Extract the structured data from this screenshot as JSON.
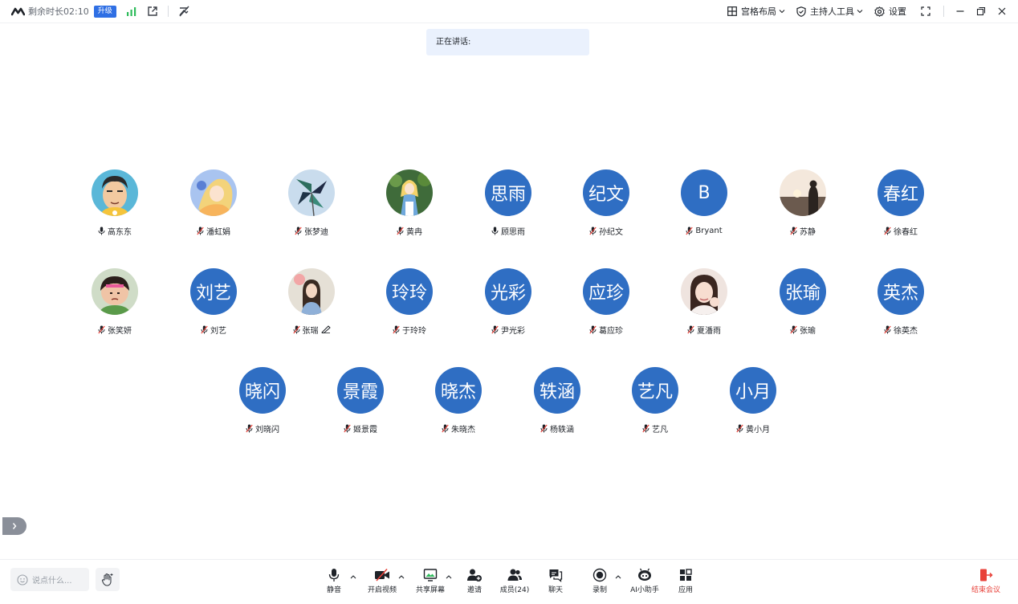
{
  "topbar": {
    "time_label": "剩余时长02:10",
    "upgrade": "升级",
    "layout_label": "宫格布局",
    "host_tools_label": "主持人工具",
    "settings_label": "设置"
  },
  "speaking_label": "正在讲话:",
  "participants": [
    {
      "name": "高东东",
      "avatar_text": "",
      "avatar_kind": "photo-man",
      "muted": false
    },
    {
      "name": "潘虹娟",
      "avatar_text": "",
      "avatar_kind": "photo-anime",
      "muted": true
    },
    {
      "name": "张梦迪",
      "avatar_text": "",
      "avatar_kind": "photo-pinwheel",
      "muted": true
    },
    {
      "name": "黄冉",
      "avatar_text": "",
      "avatar_kind": "photo-alice",
      "muted": true
    },
    {
      "name": "顾思雨",
      "avatar_text": "思雨",
      "avatar_kind": "text",
      "muted": false
    },
    {
      "name": "孙纪文",
      "avatar_text": "纪文",
      "avatar_kind": "text",
      "muted": true
    },
    {
      "name": "Bryant",
      "avatar_text": "B",
      "avatar_kind": "text",
      "muted": true
    },
    {
      "name": "苏静",
      "avatar_text": "",
      "avatar_kind": "photo-sunset",
      "muted": true
    },
    {
      "name": "徐春红",
      "avatar_text": "春红",
      "avatar_kind": "text",
      "muted": true
    },
    {
      "name": "张笑妍",
      "avatar_text": "",
      "avatar_kind": "photo-girl-cartoon",
      "muted": true
    },
    {
      "name": "刘艺",
      "avatar_text": "刘艺",
      "avatar_kind": "text",
      "muted": true
    },
    {
      "name": "张瑞",
      "avatar_text": "",
      "avatar_kind": "photo-woman",
      "muted": true,
      "annotating": true
    },
    {
      "name": "于玲玲",
      "avatar_text": "玲玲",
      "avatar_kind": "text",
      "muted": true
    },
    {
      "name": "尹光彩",
      "avatar_text": "光彩",
      "avatar_kind": "text",
      "muted": true
    },
    {
      "name": "葛应珍",
      "avatar_text": "应珍",
      "avatar_kind": "text",
      "muted": true
    },
    {
      "name": "夏潘雨",
      "avatar_text": "",
      "avatar_kind": "photo-selfie",
      "muted": true
    },
    {
      "name": "张瑜",
      "avatar_text": "张瑜",
      "avatar_kind": "text",
      "muted": true
    },
    {
      "name": "徐英杰",
      "avatar_text": "英杰",
      "avatar_kind": "text",
      "muted": true
    },
    {
      "name": "刘晓闪",
      "avatar_text": "晓闪",
      "avatar_kind": "text",
      "muted": true
    },
    {
      "name": "姬景霞",
      "avatar_text": "景霞",
      "avatar_kind": "text",
      "muted": true
    },
    {
      "name": "朱晓杰",
      "avatar_text": "晓杰",
      "avatar_kind": "text",
      "muted": true
    },
    {
      "name": "杨轶涵",
      "avatar_text": "轶涵",
      "avatar_kind": "text",
      "muted": true
    },
    {
      "name": "艺凡",
      "avatar_text": "艺凡",
      "avatar_kind": "text",
      "muted": true
    },
    {
      "name": "黄小月",
      "avatar_text": "小月",
      "avatar_kind": "text",
      "muted": true
    }
  ],
  "bottombar": {
    "say_placeholder": "说点什么...",
    "mute": "静音",
    "video": "开启视频",
    "share": "共享屏幕",
    "invite": "邀请",
    "members": "成员(24)",
    "chat": "聊天",
    "record": "录制",
    "ai_assistant": "AI小助手",
    "apps": "应用",
    "end_meeting": "结束会议"
  },
  "colors": {
    "avatar_blue": "#2f6ec3",
    "accent_blue": "#2f6fe4",
    "end_red": "#e8423a",
    "signal_green": "#2dbb5a"
  }
}
